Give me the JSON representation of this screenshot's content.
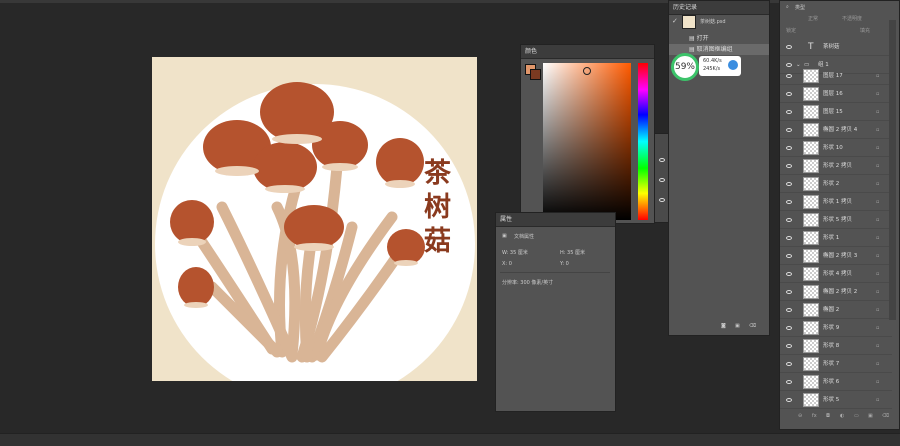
{
  "canvas": {
    "title_text": "茶树菇"
  },
  "color_panel": {
    "title": "颜色"
  },
  "properties_panel": {
    "title": "属性",
    "section": "文档属性",
    "width_label": "W: 35 厘米",
    "height_label": "H: 35 厘米",
    "x_label": "X: 0",
    "y_label": "Y: 0",
    "resolution": "分辨率: 300 像素/英寸"
  },
  "history_panel": {
    "title": "历史记录",
    "document": "茶树菇.psd",
    "items": [
      "打开",
      "取消图框编组"
    ]
  },
  "network_badge": {
    "percent": "59%",
    "upload": "60.4K/s",
    "download": "245K/s"
  },
  "layers_panel": {
    "filter_label": "类型",
    "blend_mode": "正常",
    "opacity_label": "不透明度",
    "lock_label": "锁定",
    "fill_label": "填充",
    "text_layer": "茶树菇",
    "group": "组 1",
    "layers": [
      "图层 17",
      "图层 16",
      "图层 15",
      "椭圆 2 拷贝 4",
      "形状 10",
      "形状 2 拷贝",
      "形状 2",
      "形状 1 拷贝",
      "形状 5 拷贝",
      "形状 1",
      "椭圆 2 拷贝 3",
      "形状 4 拷贝",
      "椭圆 2 拷贝 2",
      "椭圆 2",
      "形状 9",
      "形状 8",
      "形状 7",
      "形状 6",
      "形状 5"
    ]
  },
  "colors": {
    "accent_green": "#3cc36a",
    "mushroom_cap": "#b5532e",
    "canvas_bg": "#f0e3c9"
  }
}
